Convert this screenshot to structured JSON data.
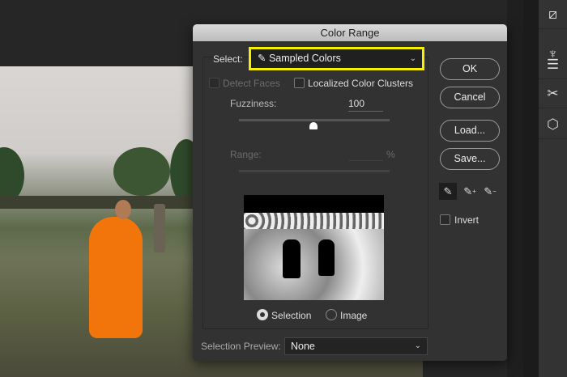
{
  "dialog": {
    "title": "Color Range",
    "select_label": "Select:",
    "select_value": "Sampled Colors",
    "detect_faces": "Detect Faces",
    "localized": "Localized Color Clusters",
    "fuzziness_label": "Fuzziness:",
    "fuzziness_value": "100",
    "fuzziness_fraction": 0.5,
    "range_label": "Range:",
    "range_unit": "%",
    "buttons": {
      "ok": "OK",
      "cancel": "Cancel",
      "load": "Load...",
      "save": "Save..."
    },
    "invert": "Invert",
    "radio_selection": "Selection",
    "radio_image": "Image",
    "selection_preview_label": "Selection Preview:",
    "selection_preview_value": "None"
  },
  "colors": {
    "highlight": "#f5f000"
  },
  "toolbar_icons": [
    "arrange-icon",
    "brushes-icon",
    "adjustments-icon",
    "tools-icon",
    "3d-cube-icon"
  ]
}
